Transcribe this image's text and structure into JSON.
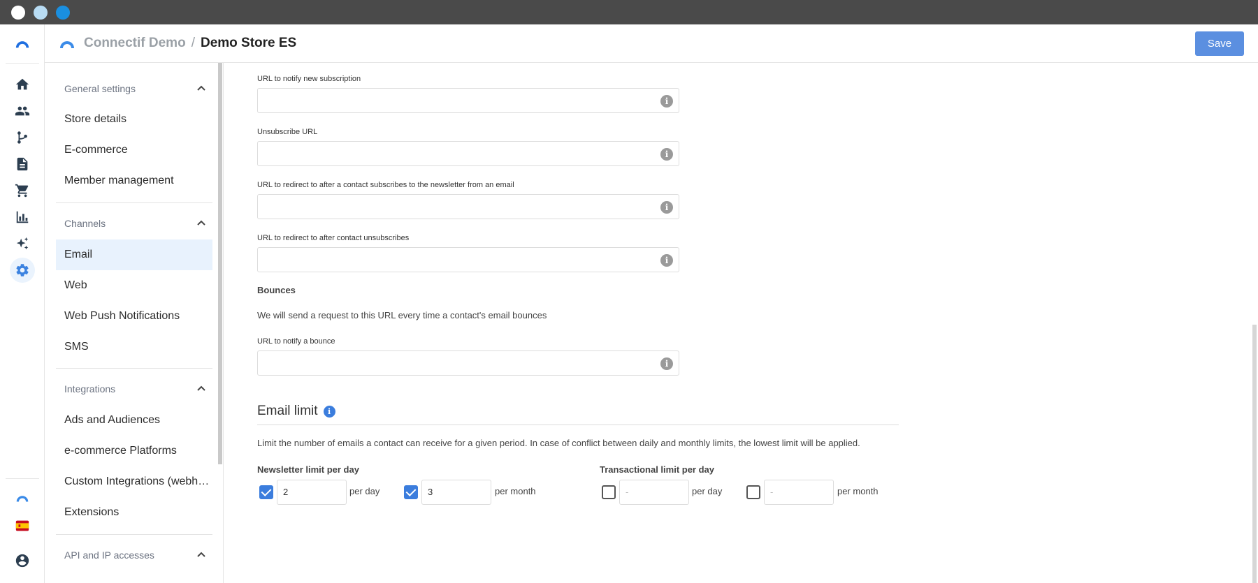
{
  "colors": {
    "accent": "#3b7ddd",
    "save_button": "#5b8fe0",
    "active_nav_bg": "#e8f2fd"
  },
  "window": {
    "controls": [
      "close",
      "minimize",
      "maximize"
    ]
  },
  "rail": {
    "items": [
      {
        "icon": "home-icon"
      },
      {
        "icon": "contacts-icon"
      },
      {
        "icon": "workflows-icon"
      },
      {
        "icon": "content-icon"
      },
      {
        "icon": "ecommerce-cart-icon"
      },
      {
        "icon": "reports-icon"
      },
      {
        "icon": "ai-sparkles-icon"
      },
      {
        "icon": "settings-gear-icon",
        "active": true
      }
    ],
    "bottom": [
      {
        "icon": "connectif-logo-icon"
      },
      {
        "icon": "spain-flag-icon"
      },
      {
        "icon": "user-account-icon"
      }
    ]
  },
  "header": {
    "org": "Connectif Demo",
    "separator": "/",
    "store": "Demo Store ES",
    "save_label": "Save"
  },
  "nav": {
    "general": {
      "title": "General settings",
      "items": [
        "Store details",
        "E-commerce",
        "Member management"
      ]
    },
    "channels": {
      "title": "Channels",
      "items": [
        "Email",
        "Web",
        "Web Push Notifications",
        "SMS"
      ],
      "active": "Email"
    },
    "integrations": {
      "title": "Integrations",
      "items": [
        "Ads and Audiences",
        "e-commerce Platforms",
        "Custom Integrations (webh…",
        "Extensions"
      ]
    },
    "api": {
      "title": "API and IP accesses"
    }
  },
  "form": {
    "subscription_url_label": "URL to notify new subscription",
    "subscription_url_value": "",
    "unsubscribe_url_label": "Unsubscribe URL",
    "unsubscribe_url_value": "",
    "redirect_subscribe_label": "URL to redirect to after a contact subscribes to the newsletter from an email",
    "redirect_subscribe_value": "",
    "redirect_unsubscribe_label": "URL to redirect to after contact unsubscribes",
    "redirect_unsubscribe_value": "",
    "bounces_title": "Bounces",
    "bounces_desc": "We will send a request to this URL every time a contact's email bounces",
    "bounce_url_label": "URL to notify a bounce",
    "bounce_url_value": ""
  },
  "email_limit": {
    "title": "Email limit",
    "desc": "Limit the number of emails a contact can receive for a given period. In case of conflict between daily and monthly limits, the lowest limit will be applied.",
    "newsletter": {
      "label": "Newsletter limit per day",
      "daily": {
        "checked": true,
        "value": "2",
        "unit": "per day"
      },
      "monthly": {
        "checked": true,
        "value": "3",
        "unit": "per month"
      }
    },
    "transactional": {
      "label": "Transactional limit per day",
      "daily": {
        "checked": false,
        "placeholder": "-",
        "unit": "per day"
      },
      "monthly": {
        "checked": false,
        "placeholder": "-",
        "unit": "per month"
      }
    }
  }
}
